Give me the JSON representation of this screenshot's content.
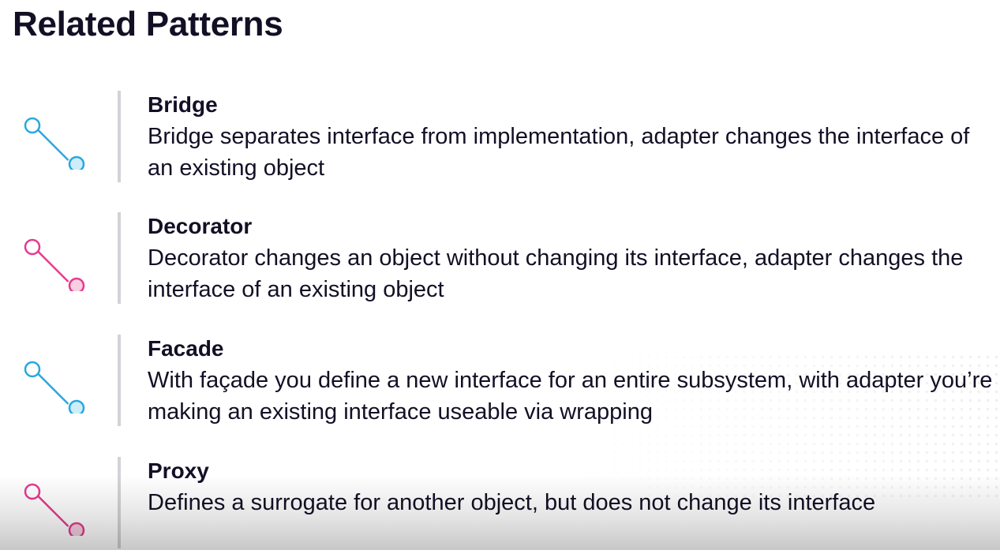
{
  "title": "Related Patterns",
  "colors": {
    "blue_accent": "#2aa7df",
    "blue_fill": "#cdeef9",
    "pink_accent": "#e63a8e",
    "pink_fill": "#f6cfe1",
    "text": "#130f25",
    "divider": "#d3d3d6"
  },
  "patterns": [
    {
      "icon": "connector-icon",
      "color": "blue",
      "name": "Bridge",
      "description": "Bridge separates interface from implementation, adapter changes the interface of an existing object"
    },
    {
      "icon": "connector-icon",
      "color": "pink",
      "name": "Decorator",
      "description": "Decorator changes an object without changing its interface, adapter changes the interface of an existing object"
    },
    {
      "icon": "connector-icon",
      "color": "blue",
      "name": "Facade",
      "description": "With façade you define a new interface for an entire subsystem, with adapter you’re making an existing interface useable via wrapping"
    },
    {
      "icon": "connector-icon",
      "color": "pink",
      "name": "Proxy",
      "description": "Defines a surrogate for another object, but does not change its interface"
    }
  ]
}
